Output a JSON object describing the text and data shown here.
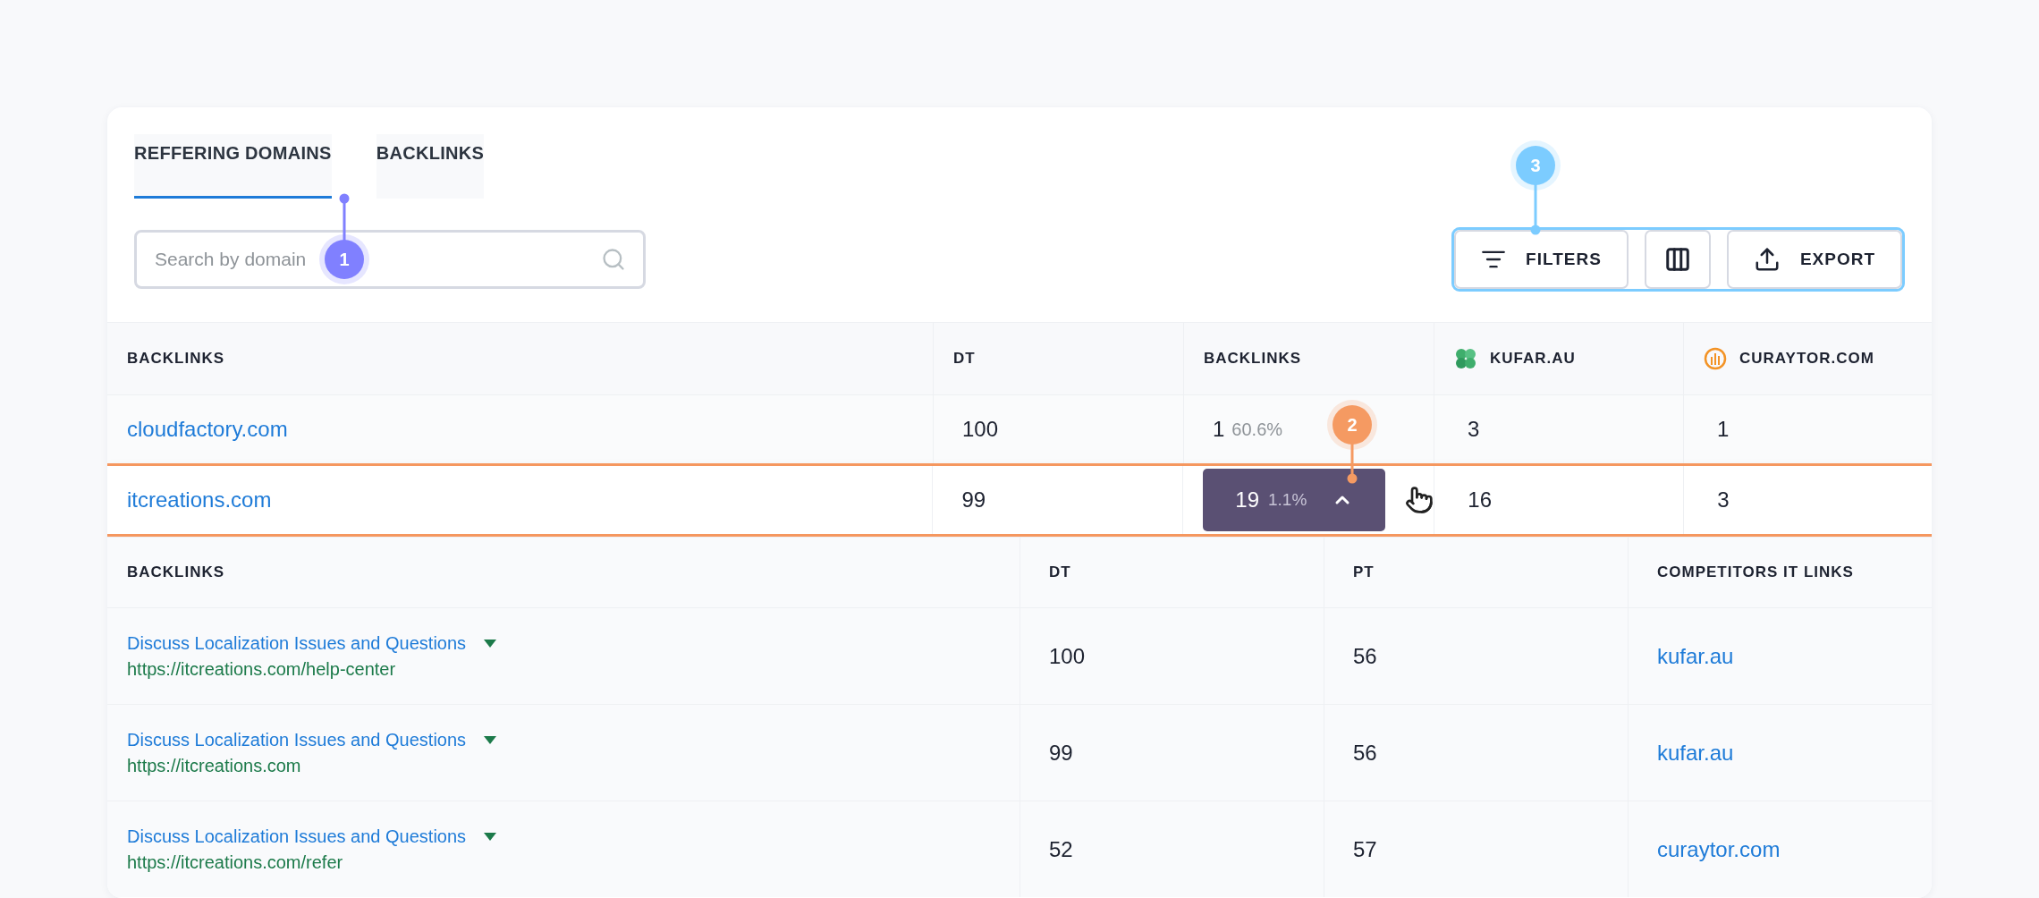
{
  "tabs": [
    {
      "label": "REFFERING DOMAINS",
      "selected": true
    },
    {
      "label": "BACKLINKS",
      "selected": false
    }
  ],
  "search": {
    "placeholder": "Search by domain"
  },
  "toolbar": [
    {
      "kind": "filter",
      "label": "FILTERS"
    },
    {
      "kind": "columns"
    },
    {
      "kind": "export",
      "label": "EXPORT"
    }
  ],
  "annotations": [
    {
      "label": "1",
      "color": "#8080ff"
    },
    {
      "label": "2",
      "color": "#f59a62"
    },
    {
      "label": "3",
      "color": "#7cccff"
    }
  ],
  "domains_table": {
    "columns": [
      {
        "kind": "plain",
        "label": "BACKLINKS"
      },
      {
        "kind": "plain",
        "label": "DT"
      },
      {
        "kind": "plain",
        "label": "BACKLINKS"
      },
      {
        "kind": "clover",
        "label": "KUFAR.AU"
      },
      {
        "kind": "bars",
        "label": "CURAYTOR.COM"
      }
    ],
    "rows": [
      {
        "domain": "cloudfactory.com",
        "dt": "100",
        "backlinks": "1",
        "share": "60.6%",
        "kufar": "3",
        "curaytor": "1",
        "expanded": false
      },
      {
        "domain": "itcreations.com",
        "dt": "99",
        "backlinks": "19",
        "share": "1.1%",
        "kufar": "16",
        "curaytor": "3",
        "expanded": true
      }
    ]
  },
  "backlinks_table": {
    "columns": [
      "BACKLINKS",
      "DT",
      "PT",
      "COMPETITORS IT LINKS"
    ],
    "rows": [
      {
        "title": "Discuss Localization Issues and Questions",
        "url": "https://itcreations.com/help-center",
        "dt": "100",
        "pt": "56",
        "competitor": "kufar.au"
      },
      {
        "title": "Discuss Localization Issues and Questions",
        "url": "https://itcreations.com",
        "dt": "99",
        "pt": "56",
        "competitor": "kufar.au"
      },
      {
        "title": "Discuss Localization Issues and Questions",
        "url": "https://itcreations.com/refer",
        "dt": "52",
        "pt": "57",
        "competitor": "curaytor.com"
      }
    ]
  }
}
